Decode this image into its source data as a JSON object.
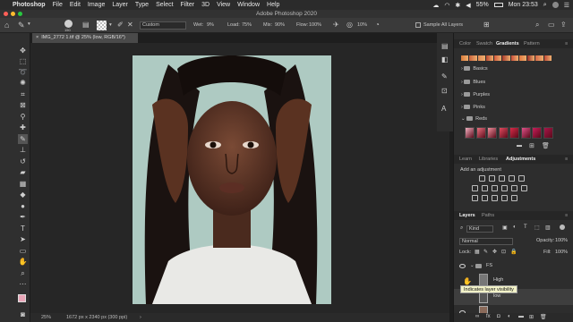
{
  "menubar": {
    "app_name": "Photoshop",
    "items": [
      "File",
      "Edit",
      "Image",
      "Layer",
      "Type",
      "Select",
      "Filter",
      "3D",
      "View",
      "Window",
      "Help"
    ],
    "battery": "55%",
    "clock": "Mon 23:53"
  },
  "window": {
    "title": "Adobe Photoshop 2020"
  },
  "options": {
    "brush_size": "150",
    "mode_value": "Custom",
    "wet_label": "Wet:",
    "wet_value": "9%",
    "load_label": "Load:",
    "load_value": "75%",
    "mix_label": "Mix:",
    "mix_value": "90%",
    "flow_label": "Flow:",
    "flow_value": "100%",
    "angle_value": "10%",
    "sample_all_layers": "Sample All Layers"
  },
  "document": {
    "tab": "IMG_2772 1.tif @ 25% (low, RGB/16*)",
    "zoom": "25%",
    "size_info": "1672 px x 2340 px (300 ppi)"
  },
  "swatches_panel": {
    "tabs": [
      "Color",
      "Swatch",
      "Gradients",
      "Pattern"
    ],
    "active_tab": "Gradients",
    "groups": [
      "Basics",
      "Blues",
      "Purples",
      "Pinks",
      "Reds"
    ],
    "gradient_colors": [
      "#d97a3a",
      "#c9603a",
      "#e08a54",
      "#b8462e",
      "#d35a3c",
      "#a83a2a",
      "#c84f3a",
      "#e0763e",
      "#9b2f26",
      "#d56846",
      "#c04a35"
    ],
    "red_gradients": [
      "#f2b0c0",
      "#e9707e",
      "#f0909c",
      "#e24a5e",
      "#d82a48",
      "#e0528a",
      "#c81e5a",
      "#a8164a"
    ]
  },
  "adjustments_panel": {
    "tabs": [
      "Learn",
      "Libraries",
      "Adjustments"
    ],
    "active_tab": "Adjustments",
    "add_label": "Add an adjustment"
  },
  "layers_panel": {
    "tabs": [
      "Layers",
      "Paths"
    ],
    "active_tab": "Layers",
    "filter_kind": "Kind",
    "blend_mode": "Normal",
    "opacity_label": "Opacity:",
    "opacity_value": "100%",
    "lock_label": "Lock:",
    "fill_label": "Fill:",
    "fill_value": "100%",
    "layers": [
      {
        "name": "FS",
        "type": "group"
      },
      {
        "name": "High",
        "type": "layer"
      },
      {
        "name": "low",
        "type": "layer"
      }
    ],
    "tooltip": "Indicates layer visibility"
  }
}
